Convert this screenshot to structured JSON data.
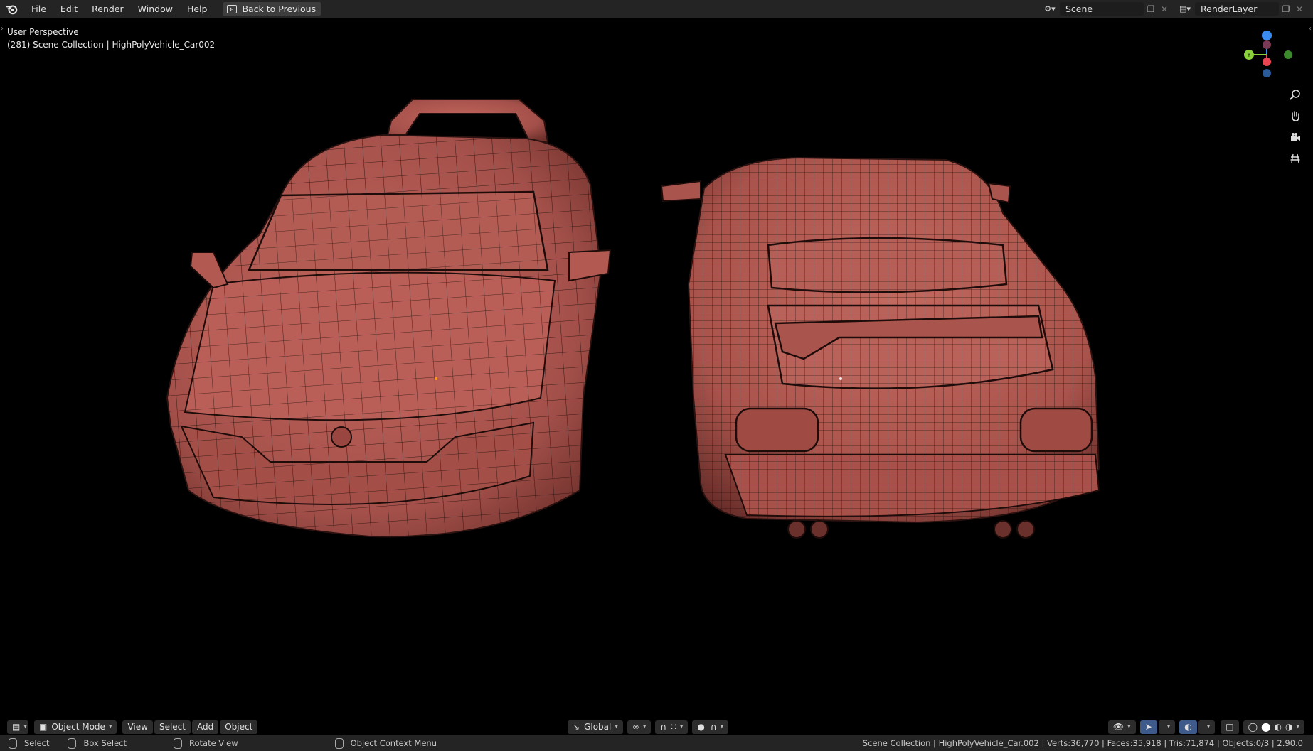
{
  "topbar": {
    "menus": [
      "File",
      "Edit",
      "Render",
      "Window",
      "Help"
    ],
    "back_button": "Back to Previous",
    "scene_field": "Scene",
    "render_layer_field": "RenderLayer"
  },
  "viewport": {
    "perspective": "User Perspective",
    "collection_info": "(281) Scene Collection | HighPolyVehicle_Car002",
    "gizmo_axes": {
      "x": "X",
      "y": "Y",
      "z": "Z"
    }
  },
  "header": {
    "mode": "Object Mode",
    "menus": [
      "View",
      "Select",
      "Add",
      "Object"
    ],
    "orientation": "Global"
  },
  "status": {
    "select": "Select",
    "box_select": "Box Select",
    "rotate_view": "Rotate View",
    "context_menu": "Object Context Menu",
    "stats": "Scene Collection | HighPolyVehicle_Car.002 | Verts:36,770 | Faces:35,918 | Tris:71,874 | Objects:0/3 | 2.90.0"
  },
  "colors": {
    "mesh": "#b55a52",
    "mesh_dark": "#7a3530",
    "wire": "#2a1210",
    "x_axis": "#e84452",
    "y_axis": "#8bd13b",
    "z_axis": "#3a8cf0"
  }
}
